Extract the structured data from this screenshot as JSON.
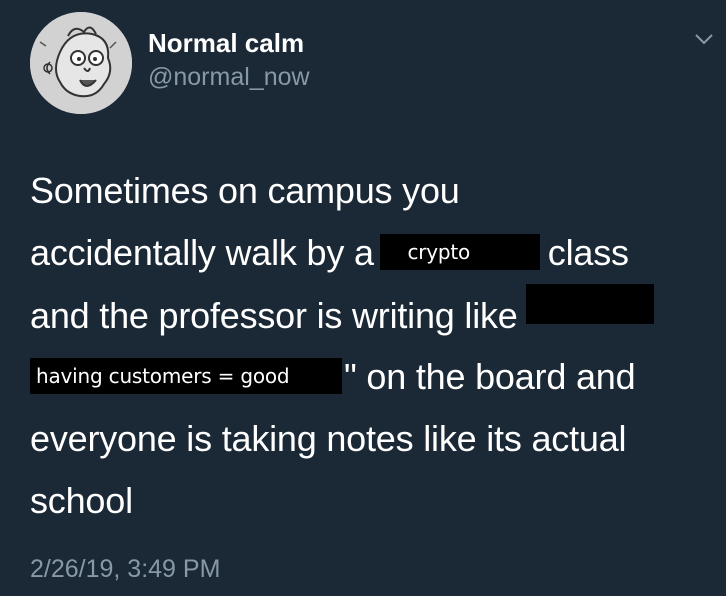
{
  "user": {
    "display_name": "Normal calm",
    "handle": "@normal_now"
  },
  "tweet": {
    "line1": "Sometimes on campus you",
    "line2_before": "accidentally walk by a",
    "redacted_word_1": "crypto",
    "line2_after": "class",
    "line3_before": "and the professor is writing like",
    "redacted_phrase": "having customers = good",
    "line4_after": "\" on the board and",
    "line5": "everyone is taking notes like its actual",
    "line6": "school",
    "timestamp": "2/26/19, 3:49 PM"
  },
  "icons": {
    "menu_caret": "chevron-down-icon",
    "avatar": "avatar"
  },
  "colors": {
    "background": "#1b2836",
    "primary_text": "#ffffff",
    "secondary_text": "#8899a6",
    "redaction": "#000000"
  }
}
